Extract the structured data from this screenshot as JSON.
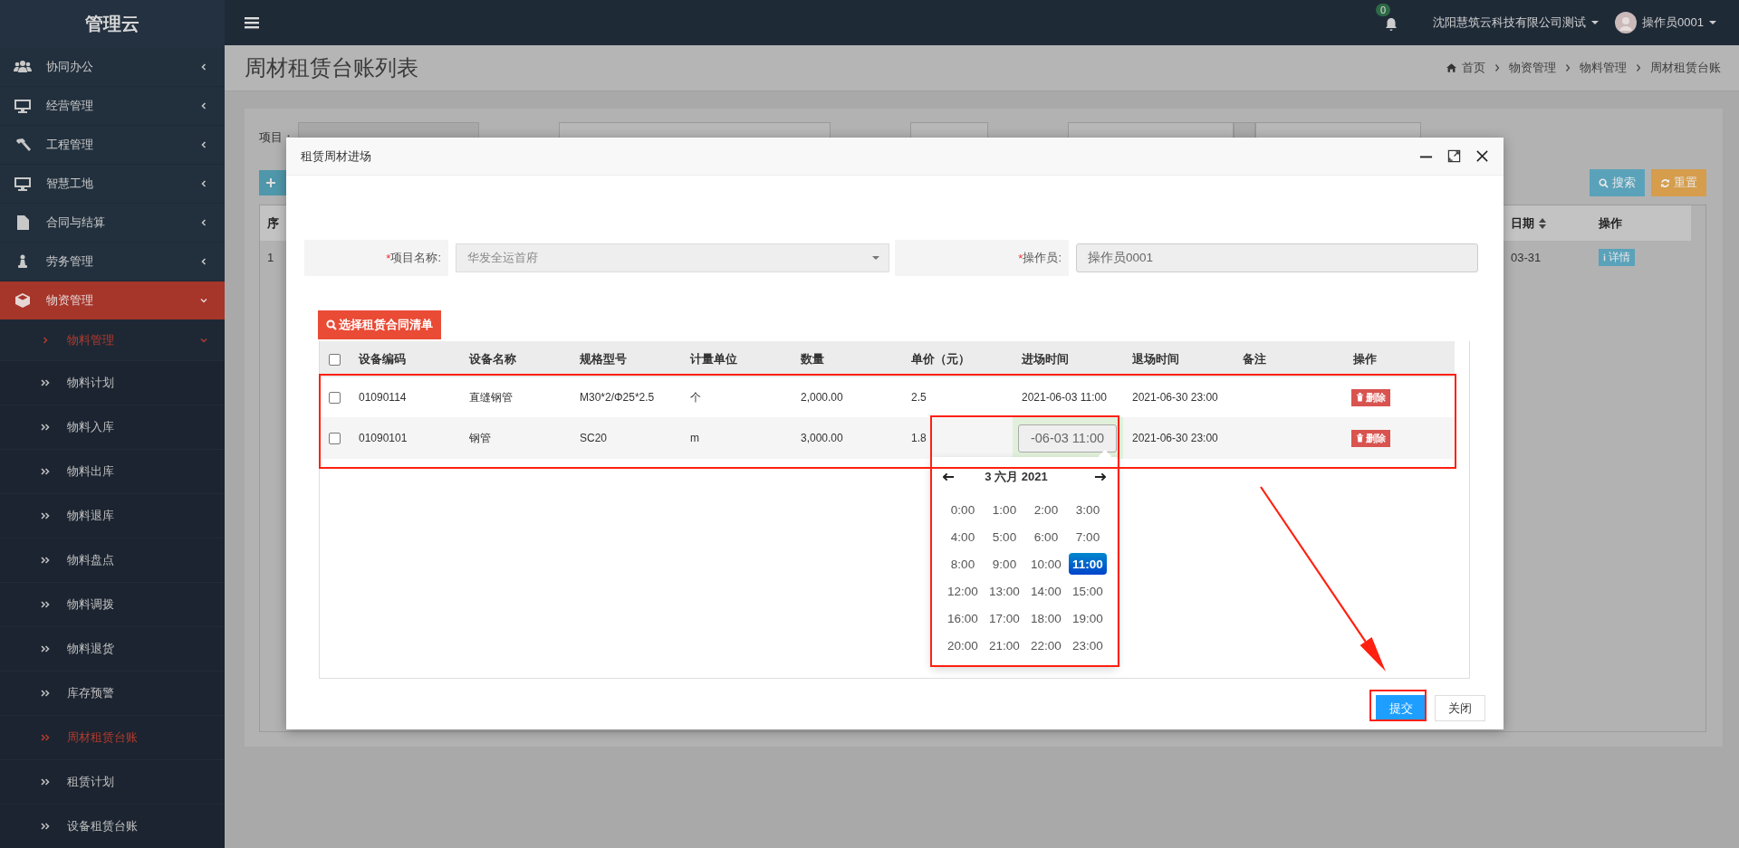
{
  "sidebar": {
    "logo": "管理云",
    "menu": [
      {
        "label": "协同办公",
        "selected": false,
        "expanded": false
      },
      {
        "label": "经营管理",
        "selected": false,
        "expanded": false
      },
      {
        "label": "工程管理",
        "selected": false,
        "expanded": false
      },
      {
        "label": "智慧工地",
        "selected": false,
        "expanded": false
      },
      {
        "label": "合同与结算",
        "selected": false,
        "expanded": false
      },
      {
        "label": "劳务管理",
        "selected": false,
        "expanded": false
      },
      {
        "label": "物资管理",
        "selected": true,
        "expanded": true,
        "children": [
          {
            "label": "物料管理",
            "selected": true,
            "expanded": true,
            "children": [
              {
                "label": "物料计划",
                "selected": false
              },
              {
                "label": "物料入库",
                "selected": false
              },
              {
                "label": "物料出库",
                "selected": false
              },
              {
                "label": "物料退库",
                "selected": false
              },
              {
                "label": "物料盘点",
                "selected": false
              },
              {
                "label": "物料调拨",
                "selected": false
              },
              {
                "label": "物料退货",
                "selected": false
              },
              {
                "label": "库存预警",
                "selected": false
              },
              {
                "label": "周材租赁台账",
                "selected": true
              },
              {
                "label": "租赁计划",
                "selected": false
              },
              {
                "label": "设备租赁台账",
                "selected": false
              }
            ]
          }
        ]
      }
    ]
  },
  "topbar": {
    "notification_count": "0",
    "company": "沈阳慧筑云科技有限公司测试",
    "user": "操作员0001"
  },
  "page": {
    "title": "周材租赁台账列表",
    "breadcrumb": [
      "首页",
      "物资管理",
      "物料管理",
      "周材租赁台账"
    ]
  },
  "filters": [
    {
      "label": "项目：",
      "kind": "select"
    },
    {
      "kind": "select"
    },
    {
      "kind": "select"
    },
    {
      "kind": "daterange"
    }
  ],
  "toolbar": [
    {
      "label": "搜索",
      "kind": "search"
    },
    {
      "label": "重置",
      "kind": "reset"
    }
  ],
  "list_table": {
    "columns": [
      {
        "label": "序",
        "sortable": false
      },
      {
        "label": "日期",
        "sortable": true
      },
      {
        "label": "操作",
        "sortable": false
      }
    ],
    "rows": [
      {
        "cells": [
          "1",
          "03-31"
        ],
        "action": "详情"
      }
    ]
  },
  "dialog": {
    "title": "租赁周材进场",
    "fields": [
      {
        "mark": "*",
        "label": "项目名称:",
        "value": "华发全运首府",
        "kind": "select"
      },
      {
        "mark": "*",
        "label": "操作员:",
        "value": "操作员0001",
        "kind": "input"
      }
    ],
    "pick_button": "选择租赁合同清单",
    "table": {
      "header_checked": false,
      "columns": [
        "设备编码",
        "设备名称",
        "规格型号",
        "计量单位",
        "数量",
        "单价（元）",
        "进场时间",
        "退场时间",
        "备注",
        "操作"
      ],
      "rows": [
        {
          "checked": false,
          "cells": [
            {
              "text": "01090114"
            },
            {
              "text": "直缝钢管"
            },
            {
              "text": "M30*2/Φ25*2.5"
            },
            {
              "text": "个"
            },
            {
              "text": "2,000.00"
            },
            {
              "text": "2.5"
            },
            {
              "text": "2021-06-03 11:00"
            },
            {
              "text": "2021-06-30 23:00"
            }
          ],
          "action": "删除"
        },
        {
          "checked": false,
          "cells": [
            {
              "text": "01090101"
            },
            {
              "text": "钢管"
            },
            {
              "text": "SC20"
            },
            {
              "text": "m"
            },
            {
              "text": "3,000.00"
            },
            {
              "text": "1.8"
            },
            {
              "text": "-06-03 11:00",
              "editing": true
            },
            {
              "text": "2021-06-30 23:00"
            }
          ],
          "action": "删除"
        }
      ]
    },
    "datepicker": {
      "title": "3 六月 2021",
      "hours": [
        {
          "label": "0:00",
          "selected": false
        },
        {
          "label": "1:00",
          "selected": false
        },
        {
          "label": "2:00",
          "selected": false
        },
        {
          "label": "3:00",
          "selected": false
        },
        {
          "label": "4:00",
          "selected": false
        },
        {
          "label": "5:00",
          "selected": false
        },
        {
          "label": "6:00",
          "selected": false
        },
        {
          "label": "7:00",
          "selected": false
        },
        {
          "label": "8:00",
          "selected": false
        },
        {
          "label": "9:00",
          "selected": false
        },
        {
          "label": "10:00",
          "selected": false
        },
        {
          "label": "11:00",
          "selected": true
        },
        {
          "label": "12:00",
          "selected": false
        },
        {
          "label": "13:00",
          "selected": false
        },
        {
          "label": "14:00",
          "selected": false
        },
        {
          "label": "15:00",
          "selected": false
        },
        {
          "label": "16:00",
          "selected": false
        },
        {
          "label": "17:00",
          "selected": false
        },
        {
          "label": "18:00",
          "selected": false
        },
        {
          "label": "19:00",
          "selected": false
        },
        {
          "label": "20:00",
          "selected": false
        },
        {
          "label": "21:00",
          "selected": false
        },
        {
          "label": "22:00",
          "selected": false
        },
        {
          "label": "23:00",
          "selected": false
        }
      ]
    },
    "buttons": [
      {
        "label": "提交",
        "kind": "primary"
      },
      {
        "label": "关闭",
        "kind": "default"
      }
    ]
  }
}
